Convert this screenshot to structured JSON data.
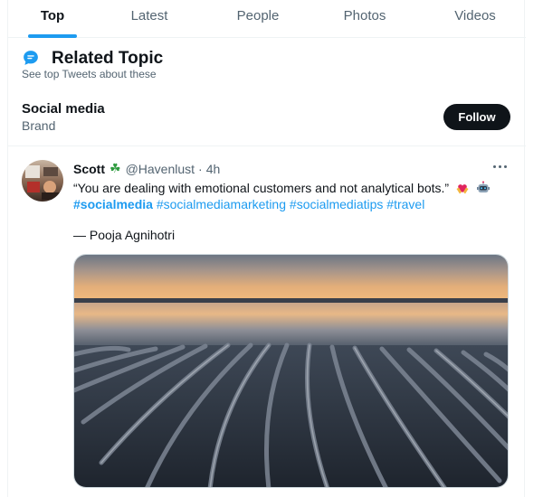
{
  "tabs": [
    {
      "label": "Top",
      "active": true
    },
    {
      "label": "Latest",
      "active": false
    },
    {
      "label": "People",
      "active": false
    },
    {
      "label": "Photos",
      "active": false
    },
    {
      "label": "Videos",
      "active": false
    }
  ],
  "related_topic": {
    "icon": "speech-bubble-icon",
    "title": "Related Topic",
    "subtitle": "See top Tweets about these"
  },
  "topic": {
    "name": "Social media",
    "category": "Brand",
    "follow_label": "Follow"
  },
  "tweet": {
    "author_name": "Scott",
    "author_badge": "☘",
    "handle": "@Havenlust",
    "dot": "·",
    "time": "4h",
    "text": "“You are dealing with emotional customers and not analytical bots.”",
    "emojis": [
      "heart-hands-icon",
      "robot-icon"
    ],
    "hashtags": [
      "#socialmedia",
      "#socialmediamarketing",
      "#socialmediatips",
      "#travel"
    ],
    "quote_author": "— Pooja Agnihotri",
    "media_description_icon": "beach-sunset-image"
  },
  "colors": {
    "accent": "#1d9bf0",
    "text_primary": "#0f1419",
    "text_secondary": "#536471",
    "button_dark": "#0f1419",
    "border": "#eff3f4"
  }
}
